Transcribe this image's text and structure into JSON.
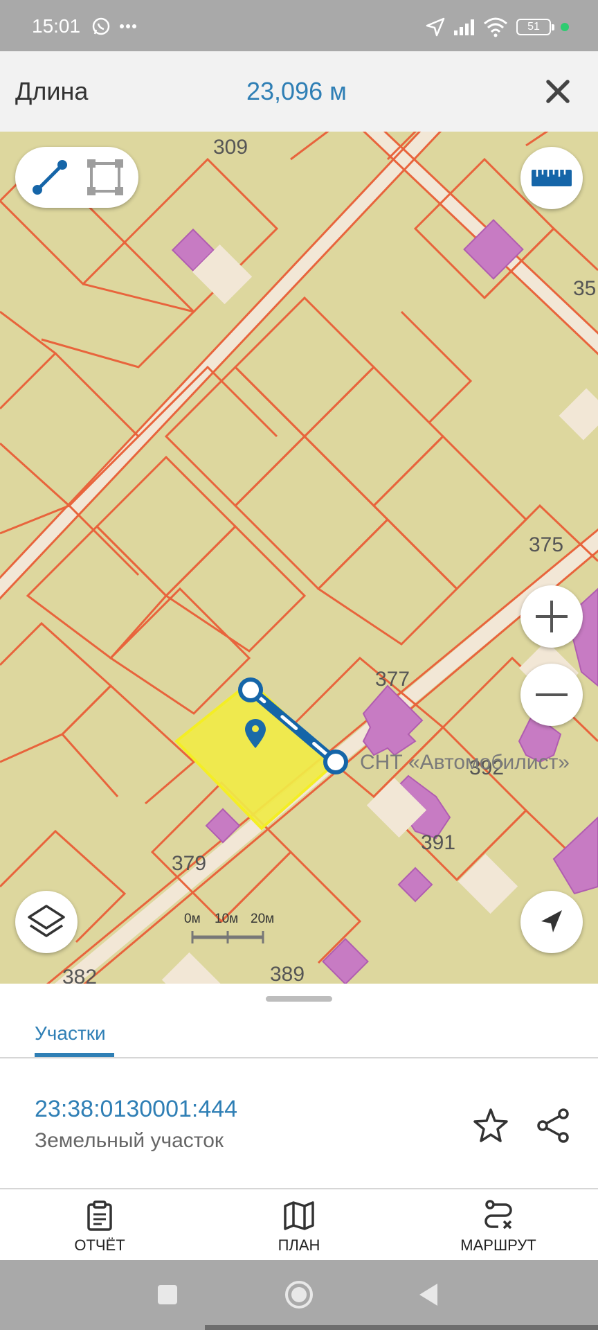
{
  "status_bar": {
    "time": "15:01",
    "battery": "51",
    "icons": [
      "whatsapp-icon",
      "more-dots-icon",
      "location-icon",
      "signal-icon",
      "wifi-icon",
      "battery-icon"
    ]
  },
  "header": {
    "label": "Длина",
    "value": "23,096 м",
    "close_icon": "close-icon"
  },
  "map": {
    "parcel_numbers": [
      "309",
      "35",
      "375",
      "377",
      "392",
      "391",
      "379",
      "382",
      "389"
    ],
    "area_label": "СНТ «Автомобилист»",
    "scale_labels": [
      "0м",
      "10м",
      "20м"
    ],
    "colors": {
      "background": "#ddd79e",
      "parcel_border": "#e8643c",
      "road": "#f2e7d6",
      "building": "#c77bc3",
      "selected_parcel": "#f0ea48",
      "measure_line": "#1565a8"
    }
  },
  "tabs": [
    {
      "label": "Участки",
      "active": true
    }
  ],
  "parcel": {
    "cadastral_number": "23:38:0130001:444",
    "type": "Земельный участок"
  },
  "bottom_nav": [
    {
      "label": "ОТЧЁТ",
      "icon": "report-icon"
    },
    {
      "label": "ПЛАН",
      "icon": "map-plan-icon"
    },
    {
      "label": "МАРШРУТ",
      "icon": "route-icon"
    }
  ]
}
